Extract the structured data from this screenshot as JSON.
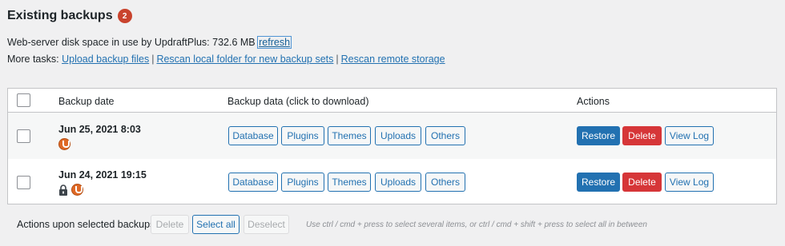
{
  "header": {
    "title": "Existing backups",
    "count": "2"
  },
  "disk": {
    "label": "Web-server disk space in use by UpdraftPlus:",
    "value": "732.6 MB",
    "refresh": "refresh"
  },
  "tasks": {
    "label": "More tasks:",
    "links": [
      "Upload backup files",
      "Rescan local folder for new backup sets",
      "Rescan remote storage"
    ]
  },
  "table": {
    "headers": {
      "date": "Backup date",
      "data": "Backup data (click to download)",
      "actions": "Actions"
    },
    "rows": [
      {
        "date": "Jun 25, 2021 8:03",
        "locked": false,
        "data_buttons": [
          "Database",
          "Plugins",
          "Themes",
          "Uploads",
          "Others"
        ],
        "actions": [
          "Restore",
          "Delete",
          "View Log"
        ]
      },
      {
        "date": "Jun 24, 2021 19:15",
        "locked": true,
        "data_buttons": [
          "Database",
          "Plugins",
          "Themes",
          "Uploads",
          "Others"
        ],
        "actions": [
          "Restore",
          "Delete",
          "View Log"
        ]
      }
    ]
  },
  "footer": {
    "label": "Actions upon selected backups",
    "delete": "Delete",
    "select_all": "Select all",
    "deselect": "Deselect",
    "hint": "Use ctrl / cmd + press to select several items, or ctrl / cmd + shift + press to select all in between"
  },
  "colors": {
    "accent": "#2271b1",
    "danger": "#d63638",
    "badge": "#c9432d",
    "updraft_orange": "#df6926"
  }
}
